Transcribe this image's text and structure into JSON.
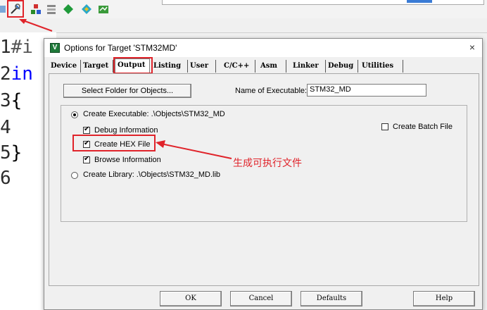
{
  "editor": {
    "line_numbers": [
      "1",
      "2",
      "3",
      "4",
      "5",
      "6"
    ],
    "code_fragments": [
      "#i",
      "in",
      "{",
      "",
      "}",
      ""
    ]
  },
  "dialog": {
    "title": "Options for Target 'STM32MD'",
    "close": "×",
    "tabs": [
      "Device",
      "Target",
      "Output",
      "Listing",
      "User",
      "C/C++",
      "Asm",
      "Linker",
      "Debug",
      "Utilities"
    ],
    "active_tab": "Output",
    "output": {
      "select_folder_label": "Select Folder for Objects...",
      "name_of_executable_label": "Name of Executable:",
      "executable_value": "STM32_MD",
      "create_executable_label": "Create Executable:  .\\Objects\\STM32_MD",
      "debug_info_label": "Debug Information",
      "create_hex_label": "Create HEX File",
      "browse_info_label": "Browse Information",
      "create_library_label": "Create Library:  .\\Objects\\STM32_MD.lib",
      "create_batch_label": "Create Batch File",
      "debug_info_checked": true,
      "create_hex_checked": true,
      "browse_info_checked": true,
      "create_batch_checked": false
    },
    "buttons": {
      "ok": "OK",
      "cancel": "Cancel",
      "defaults": "Defaults",
      "help": "Help"
    }
  },
  "annotation": {
    "text": "生成可执行文件",
    "color": "#e0232a"
  },
  "colors": {
    "highlight": "#e0232a",
    "keyword": "#0000ff"
  }
}
